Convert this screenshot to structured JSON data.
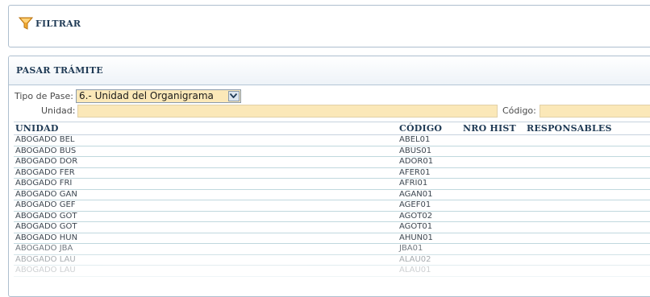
{
  "filter_bar": {
    "label": "FILTRAR",
    "icon": "funnel-icon"
  },
  "tramite": {
    "title": "PASAR TRÁMITE",
    "tipo_pase_label": "Tipo de Pase:",
    "tipo_pase_value": "6.- Unidad del Organigrama",
    "unidad_label": "Unidad:",
    "unidad_value": "",
    "codigo_label": "Código:",
    "codigo_value": ""
  },
  "grid": {
    "columns": [
      "UNIDAD",
      "CÓDIGO",
      "NRO HIST",
      "RESPONSABLES"
    ],
    "rows": [
      {
        "unidad": "ABOGADO BEL",
        "codigo": "ABEL01"
      },
      {
        "unidad": "ABOGADO BUS",
        "codigo": "ABUS01"
      },
      {
        "unidad": "ABOGADO DOR",
        "codigo": "ADOR01"
      },
      {
        "unidad": "ABOGADO FER",
        "codigo": "AFER01"
      },
      {
        "unidad": "ABOGADO FRI",
        "codigo": "AFRI01"
      },
      {
        "unidad": "ABOGADO GAN",
        "codigo": "AGAN01"
      },
      {
        "unidad": "ABOGADO GEF",
        "codigo": "AGEF01"
      },
      {
        "unidad": "ABOGADO GOT",
        "codigo": "AGOT02"
      },
      {
        "unidad": "ABOGADO GOT",
        "codigo": "AGOT01"
      },
      {
        "unidad": "ABOGADO HUN",
        "codigo": "AHUN01"
      },
      {
        "unidad": "ABOGADO JBA",
        "codigo": "JBA01"
      },
      {
        "unidad": "ABOGADO LAU",
        "codigo": "ALAU02"
      },
      {
        "unidad": "ABOGADO LAU",
        "codigo": "ALAU01"
      }
    ]
  },
  "colors": {
    "header_text": "#1f3a55",
    "input_bg": "#fbe8b8",
    "row_divider": "#c0d8de",
    "filter_icon": "#e8a020"
  }
}
